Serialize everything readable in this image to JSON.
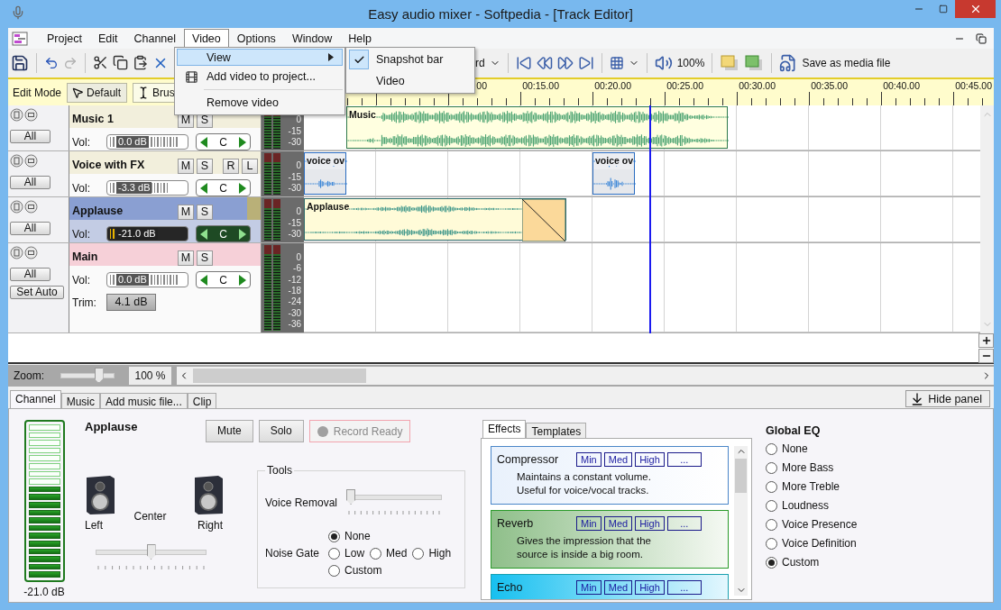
{
  "window": {
    "title": "Easy audio mixer - Softpedia - [Track Editor]"
  },
  "menu": [
    {
      "label": "Project",
      "selected": false
    },
    {
      "label": "Edit",
      "selected": false
    },
    {
      "label": "Channel",
      "selected": false
    },
    {
      "label": "Video",
      "selected": true
    },
    {
      "label": "Options",
      "selected": false
    },
    {
      "label": "Window",
      "selected": false
    },
    {
      "label": "Help",
      "selected": false
    }
  ],
  "video_menu": [
    {
      "kind": "submenu",
      "label": "View",
      "highlighted": true
    },
    {
      "kind": "item",
      "label": "Add video to project...",
      "highlighted": false
    },
    {
      "kind": "separator"
    },
    {
      "kind": "item",
      "label": "Remove video",
      "highlighted": false
    }
  ],
  "view_submenu": [
    {
      "label": "Snapshot bar",
      "checked": true
    },
    {
      "label": "Video",
      "checked": false
    }
  ],
  "toolbar": {
    "record_partial": "rd",
    "volume": "100%",
    "save_label": "Save as media file"
  },
  "edit_mode": {
    "label": "Edit Mode",
    "tools": [
      {
        "label": "Default",
        "selected": true
      },
      {
        "label": "Brus",
        "selected": false
      }
    ]
  },
  "ruler": [
    "00",
    "00:15.00",
    "00:20.00",
    "00:25.00",
    "00:30.00",
    "00:35.00",
    "00:40.00",
    "00:45.00"
  ],
  "tracks": [
    {
      "name": "Music 1",
      "color": "#f2efdc",
      "selected": false,
      "buttons": [
        "M",
        "S"
      ],
      "all": "All",
      "vol_label": "Vol:",
      "volume": "0.0 dB",
      "level": 0.9,
      "pan": "C",
      "meter_ticks": [
        "0",
        "-15",
        "-30"
      ],
      "clips": [
        {
          "label": "Music",
          "kind": "music"
        }
      ]
    },
    {
      "name": "Voice with FX",
      "color": "#f2efdc",
      "selected": false,
      "buttons": [
        "M",
        "S",
        "R",
        "L"
      ],
      "all": "All",
      "vol_label": "Vol:",
      "volume": "-3.3 dB",
      "level": 0.78,
      "pan": "C",
      "meter_ticks": [
        "0",
        "-15",
        "-30"
      ],
      "clips": [
        {
          "label": "voice ov",
          "kind": "voice"
        },
        {
          "label": "voice ov",
          "kind": "voice"
        }
      ]
    },
    {
      "name": "Applause",
      "color": "#8a9fd2",
      "selected": true,
      "buttons": [
        "M",
        "S"
      ],
      "all": "All",
      "vol_label": "Vol:",
      "volume": "-21.0 dB",
      "level": 0.37,
      "pan": "C",
      "meter_ticks": [
        "0",
        "-15",
        "-30"
      ],
      "clips": [
        {
          "label": "Applause",
          "kind": "applause"
        }
      ]
    },
    {
      "name": "Main",
      "color": "#f6d0d8",
      "selected": false,
      "buttons": [
        "M",
        "S"
      ],
      "all": "All",
      "vol_label": "Vol:",
      "volume": "0.0 dB",
      "level": 0.9,
      "pan": "C",
      "meter_ticks": [
        "0",
        "-6",
        "-12",
        "-18",
        "-24",
        "-30",
        "-36"
      ],
      "extra": {
        "set_auto": "Set Auto",
        "trim_label": "Trim:",
        "trim": "4.1 dB"
      }
    }
  ],
  "zoom": {
    "label": "Zoom:",
    "level": 0.75,
    "value": "100 %"
  },
  "panel_tabs": [
    {
      "label": "Channel",
      "selected": true
    },
    {
      "label": "Music",
      "selected": false
    },
    {
      "label": "Add music file...",
      "selected": false
    },
    {
      "label": "Clip",
      "selected": false
    }
  ],
  "hide_panel": "Hide panel",
  "channel": {
    "name": "Applause",
    "meter": {
      "level": 0.6
    },
    "meter_reading": "-21.0 dB",
    "mute": "Mute",
    "solo": "Solo",
    "record": "Record Ready",
    "record_on": false,
    "left": "Left",
    "center": "Center",
    "right": "Right",
    "pan": {
      "level": 0.5
    }
  },
  "tools": {
    "title": "Tools",
    "voice_removal": "Voice Removal",
    "voice_removal_slider": {
      "level": 0
    },
    "noise_gate": "Noise Gate",
    "options": [
      {
        "label": "None",
        "selected": true
      },
      {
        "label": "Low",
        "selected": false
      },
      {
        "label": "Med",
        "selected": false
      },
      {
        "label": "High",
        "selected": false
      },
      {
        "label": "Custom",
        "selected": false
      }
    ]
  },
  "effects": {
    "tabs": [
      {
        "label": "Effects",
        "selected": true
      },
      {
        "label": "Templates",
        "selected": false
      }
    ],
    "items": [
      {
        "kind": "compressor",
        "name": "Compressor",
        "buttons": [
          "Min",
          "Med",
          "High",
          "..."
        ],
        "description": "Maintains a constant volume.\nUseful for voice/vocal tracks."
      },
      {
        "kind": "reverb",
        "name": "Reverb",
        "buttons": [
          "Min",
          "Med",
          "High",
          "..."
        ],
        "description": "Gives the impression that the\nsource is inside a big room."
      },
      {
        "kind": "echo",
        "name": "Echo",
        "buttons": [
          "Min",
          "Med",
          "High",
          "..."
        ]
      }
    ]
  },
  "global_eq": {
    "title": "Global EQ",
    "options": [
      {
        "label": "None",
        "selected": false
      },
      {
        "label": "More Bass",
        "selected": false
      },
      {
        "label": "More Treble",
        "selected": false
      },
      {
        "label": "Loudness",
        "selected": false
      },
      {
        "label": "Voice Presence",
        "selected": false
      },
      {
        "label": "Voice Definition",
        "selected": false
      },
      {
        "label": "Custom",
        "selected": true
      }
    ]
  }
}
